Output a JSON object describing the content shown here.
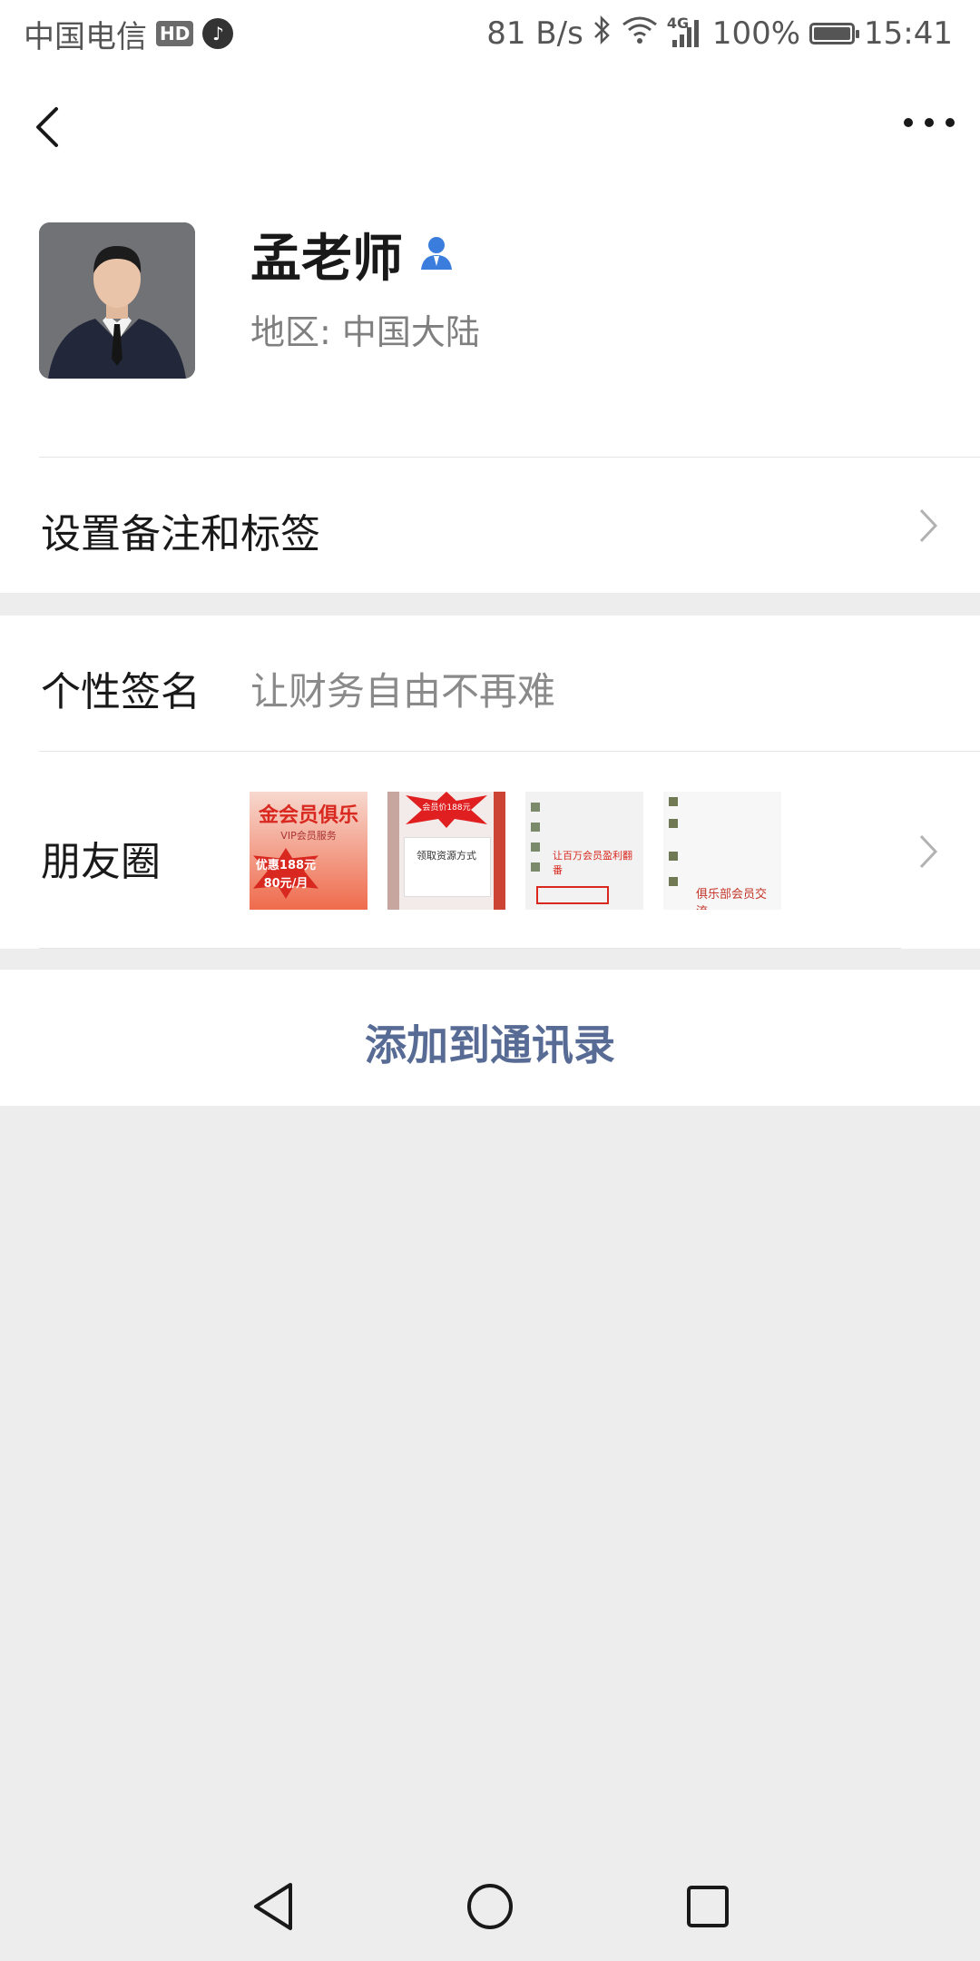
{
  "status_bar": {
    "carrier": "中国电信",
    "hd_badge": "HD",
    "net_speed": "81 B/s",
    "network_type": "4G",
    "battery": "100%",
    "time": "15:41"
  },
  "profile": {
    "name": "孟老师",
    "region": "地区: 中国大陆"
  },
  "rows": {
    "remark_label": "设置备注和标签",
    "signature_label": "个性签名",
    "signature_value": "让财务自由不再难",
    "moments_label": "朋友圈",
    "moments_thumbs": [
      {
        "caption": "金会员俱乐",
        "sub1": "优惠188元",
        "sub2": "80元/月",
        "vip": "VIP会员服务"
      },
      {
        "caption": "领取资源方式",
        "badge": "会员价188元"
      },
      {
        "caption": "让百万会员盈利翻番"
      },
      {
        "caption": "俱乐部会员交流"
      }
    ]
  },
  "actions": {
    "add_contact": "添加到通讯录"
  },
  "colors": {
    "link_blue": "#576b95",
    "page_bg": "#ededed",
    "verified_icon": "#3b7ddd"
  }
}
